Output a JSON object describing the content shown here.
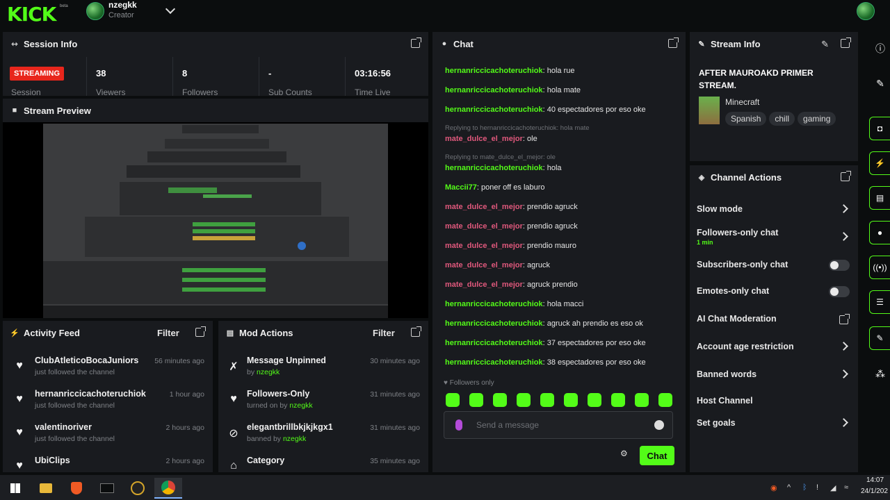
{
  "brand": {
    "logo": "KICK",
    "beta": "beta"
  },
  "user": {
    "name": "nzegkk",
    "role": "Creator"
  },
  "session": {
    "title": "Session Info",
    "status": "STREAMING",
    "status_label": "Session",
    "stats": [
      {
        "value": "38",
        "label": "Viewers"
      },
      {
        "value": "8",
        "label": "Followers"
      },
      {
        "value": "-",
        "label": "Sub Counts"
      },
      {
        "value": "03:16:56",
        "label": "Time Live"
      }
    ]
  },
  "preview": {
    "title": "Stream Preview"
  },
  "activity": {
    "title": "Activity Feed",
    "filter": "Filter",
    "items": [
      {
        "name": "ClubAtleticoBocaJuniors",
        "sub": "just followed the channel",
        "time": "56 minutes ago"
      },
      {
        "name": "hernanriccicachoteruchiok",
        "sub": "just followed the channel",
        "time": "1 hour ago"
      },
      {
        "name": "valentinoriver",
        "sub": "just followed the channel",
        "time": "2 hours ago"
      },
      {
        "name": "UbiClips",
        "sub": "",
        "time": "2 hours ago"
      }
    ]
  },
  "mod": {
    "title": "Mod Actions",
    "filter": "Filter",
    "items": [
      {
        "name": "Message Unpinned",
        "sub_prefix": "by ",
        "sub_user": "nzegkk",
        "time": "30 minutes ago"
      },
      {
        "name": "Followers-Only",
        "sub_prefix": "turned on by ",
        "sub_user": "nzegkk",
        "time": "31 minutes ago"
      },
      {
        "name": "elegantbrillbkjkjkgx1",
        "sub_prefix": "banned by ",
        "sub_user": "nzegkk",
        "time": "31 minutes ago"
      },
      {
        "name": "Category",
        "sub_prefix": "",
        "sub_user": "",
        "time": "35 minutes ago"
      }
    ]
  },
  "chat": {
    "title": "Chat",
    "messages": [
      {
        "user": "hernanriccicachoteruchiok",
        "text": ": hola rue",
        "color": "green"
      },
      {
        "user": "hernanriccicachoteruchiok",
        "text": ": hola mate",
        "color": "green"
      },
      {
        "user": "hernanriccicachoteruchiok",
        "text": ": 40 espectadores por eso oke",
        "color": "green"
      },
      {
        "reply": "Replying to hernanriccicachoteruchiok: hola mate"
      },
      {
        "user": "mate_dulce_el_mejor",
        "text": ": ole",
        "color": "pink"
      },
      {
        "reply": "Replying to mate_dulce_el_mejor: ole"
      },
      {
        "user": "hernanriccicachoteruchiok",
        "text": ": hola",
        "color": "green"
      },
      {
        "user": "Maccii77",
        "text": ": poner off es laburo",
        "color": "green"
      },
      {
        "user": "mate_dulce_el_mejor",
        "text": ": prendio agruck",
        "color": "pink"
      },
      {
        "user": "mate_dulce_el_mejor",
        "text": ": prendio agruck",
        "color": "pink"
      },
      {
        "user": "mate_dulce_el_mejor",
        "text": ": prendio mauro",
        "color": "pink"
      },
      {
        "user": "mate_dulce_el_mejor",
        "text": ": agruck",
        "color": "pink"
      },
      {
        "user": "mate_dulce_el_mejor",
        "text": ": agruck prendio",
        "color": "pink"
      },
      {
        "user": "hernanriccicachoteruchiok",
        "text": ": hola macci",
        "color": "green"
      },
      {
        "user": "hernanriccicachoteruchiok",
        "text": ": agruck ah prendio es eso ok",
        "color": "green"
      },
      {
        "user": "hernanriccicachoteruchiok",
        "text": ": 37 espectadores por eso oke",
        "color": "green"
      },
      {
        "user": "hernanriccicachoteruchiok",
        "text": ": 38 espectadores por eso oke",
        "color": "green"
      }
    ],
    "mode": "Followers only",
    "placeholder": "Send a message",
    "send_label": "Chat"
  },
  "stream_info": {
    "title": "Stream Info",
    "stream_title": "AFTER MAUROAKD PRIMER STREAM.",
    "category": "Minecraft",
    "tags": [
      "Spanish",
      "chill",
      "gaming"
    ]
  },
  "channel_actions": {
    "title": "Channel Actions",
    "items": [
      {
        "label": "Slow mode",
        "control": "chevron"
      },
      {
        "label": "Followers-only chat",
        "sub": "1 min",
        "control": "chevron"
      },
      {
        "label": "Subscribers-only chat",
        "control": "toggle"
      },
      {
        "label": "Emotes-only chat",
        "control": "toggle"
      },
      {
        "label": "AI Chat Moderation",
        "control": "popout"
      },
      {
        "label": "Account age restriction",
        "control": "chevron"
      },
      {
        "label": "Banned words",
        "control": "chevron"
      },
      {
        "label": "Host Channel",
        "control": "none"
      },
      {
        "label": "Set goals",
        "control": "chevron"
      }
    ]
  },
  "taskbar": {
    "time": "14:07",
    "date": "24/1/202"
  },
  "colors": {
    "accent": "#53fc18",
    "panel": "#191b1f",
    "background": "#0b0d0e",
    "streaming": "#e8261c"
  }
}
